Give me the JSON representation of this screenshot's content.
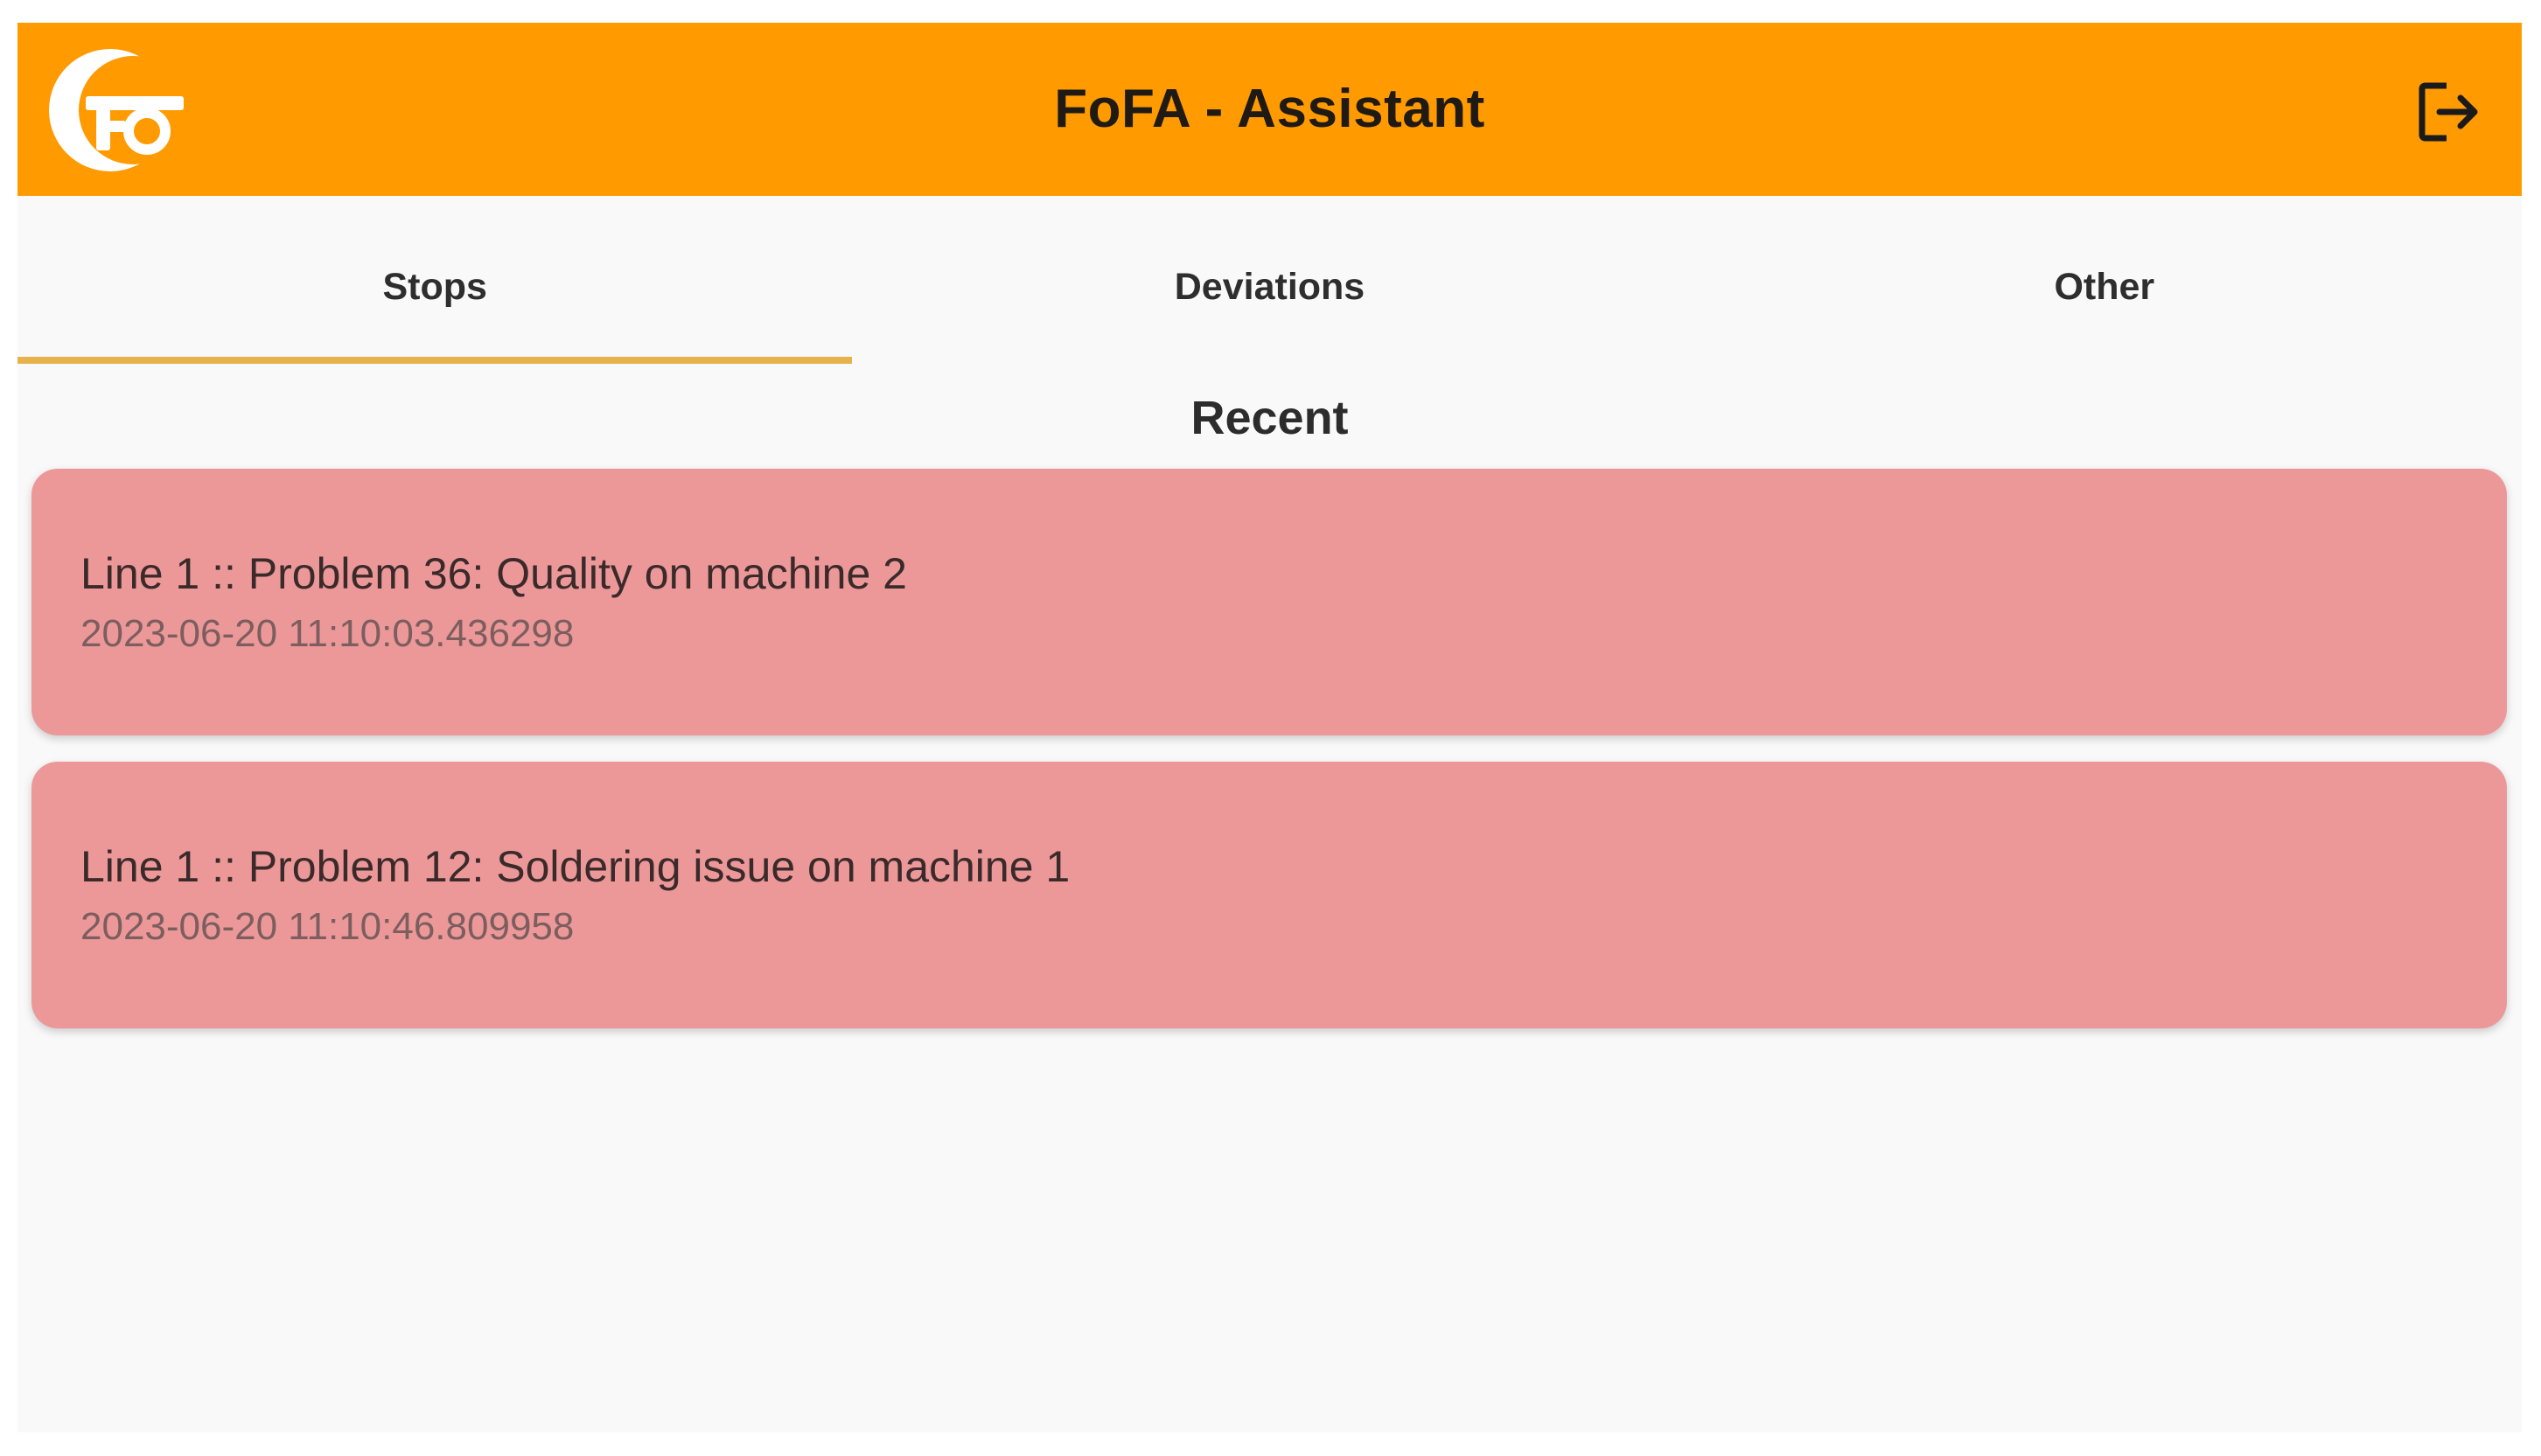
{
  "appbar": {
    "title": "FoFA - Assistant",
    "logo_icon": "fofa-logo-icon",
    "logout_icon": "logout-icon",
    "background_color": "#ff9a00"
  },
  "tabs": [
    {
      "label": "Stops",
      "active": true
    },
    {
      "label": "Deviations",
      "active": false
    },
    {
      "label": "Other",
      "active": false
    }
  ],
  "section": {
    "title": "Recent"
  },
  "stops": [
    {
      "title": "Line 1 :: Problem 36: Quality on machine 2",
      "timestamp": "2023-06-20 11:10:03.436298"
    },
    {
      "title": "Line 1 :: Problem 12: Soldering issue on machine 1",
      "timestamp": "2023-06-20 11:10:46.809958"
    }
  ],
  "colors": {
    "card_background": "#ec9899",
    "tab_indicator": "#e5b24c"
  }
}
